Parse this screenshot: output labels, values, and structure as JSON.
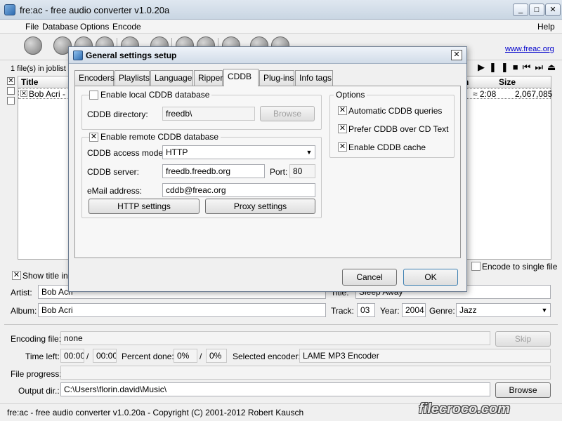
{
  "app": {
    "title": "fre:ac - free audio converter v1.0.20a",
    "minimize": "_",
    "maximize": "□",
    "close": "✕",
    "menu": [
      "File",
      "Database",
      "Options",
      "Encode"
    ],
    "help": "Help",
    "website": "www.freac.org",
    "joblist_count": "1 file(s) in joblist (",
    "columns": {
      "title": "Title",
      "time": "n",
      "size": "Size"
    },
    "rows": [
      {
        "title": "Bob Acri - S",
        "time": "≈ 2:08",
        "size": "2,067,085"
      }
    ],
    "play_controls": "▶❚❚■⏮⏭⏏",
    "encode_single": "Encode to single file",
    "show_title_info": "Show title info",
    "artist_label": "Artist:",
    "artist_value": "Bob Acri",
    "title_label": "Title:",
    "title_value": "Sleep Away",
    "album_label": "Album:",
    "album_value": "Bob Acri",
    "track_label": "Track:",
    "track_value": "03",
    "year_label": "Year:",
    "year_value": "2004",
    "genre_label": "Genre:",
    "genre_value": "Jazz",
    "encoding_file_label": "Encoding file:",
    "encoding_file_value": "none",
    "skip": "Skip",
    "time_left_label": "Time left:",
    "time_left_a": "00:00",
    "time_slash": "/",
    "time_left_b": "00:00",
    "percent_label": "Percent done:",
    "percent_a": "0%",
    "percent_slash": "/",
    "percent_b": "0%",
    "selected_encoder_label": "Selected encoder:",
    "selected_encoder_value": "LAME MP3 Encoder",
    "file_progress_label": "File progress:",
    "output_dir_label": "Output dir.:",
    "output_dir_value": "C:\\Users\\florin.david\\Music\\",
    "browse": "Browse",
    "status": "fre:ac - free audio converter v1.0.20a - Copyright (C) 2001-2012 Robert Kausch",
    "watermark": "filecroco.com"
  },
  "dialog": {
    "title": "General settings setup",
    "close": "✕",
    "tabs": [
      "Encoders",
      "Playlists",
      "Language",
      "Ripper",
      "CDDB",
      "Plug-ins",
      "Info tags"
    ],
    "active_tab": "CDDB",
    "local_db_label": "Enable local CDDB database",
    "cddb_dir_label": "CDDB directory:",
    "cddb_dir_value": "freedb\\",
    "browse": "Browse",
    "remote_db_label": "Enable remote CDDB database",
    "access_mode_label": "CDDB access mode:",
    "access_mode_value": "HTTP",
    "server_label": "CDDB server:",
    "server_value": "freedb.freedb.org",
    "port_label": "Port:",
    "port_value": "80",
    "email_label": "eMail address:",
    "email_value": "cddb@freac.org",
    "http_settings": "HTTP settings",
    "proxy_settings": "Proxy settings",
    "options_title": "Options",
    "opt_auto": "Automatic CDDB queries",
    "opt_prefer": "Prefer CDDB over CD Text",
    "opt_cache": "Enable CDDB cache",
    "cancel": "Cancel",
    "ok": "OK",
    "check_mark": "✕"
  }
}
